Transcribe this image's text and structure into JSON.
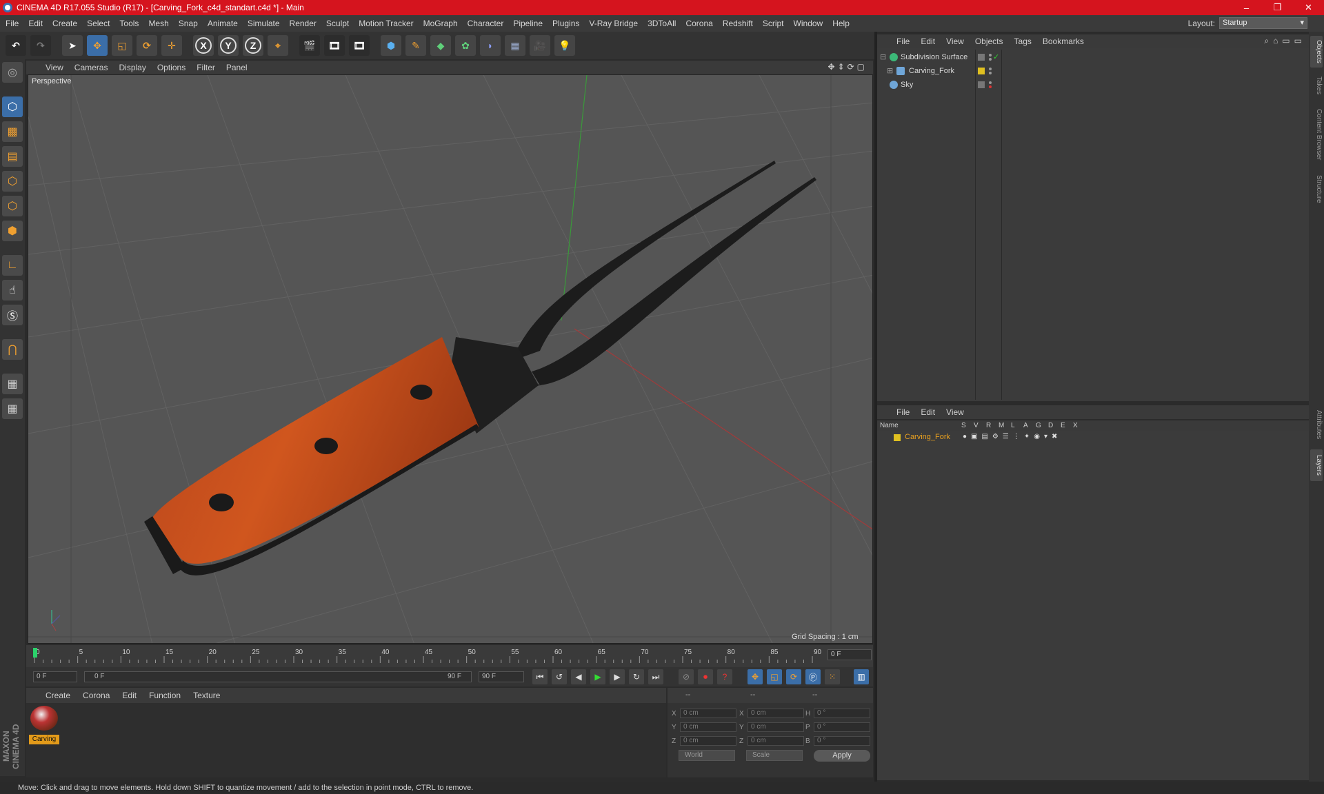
{
  "window": {
    "title": "CINEMA 4D R17.055 Studio (R17) - [Carving_Fork_c4d_standart.c4d *] - Main",
    "controls": [
      "–",
      "❐",
      "✕"
    ]
  },
  "menu": [
    "File",
    "Edit",
    "Create",
    "Select",
    "Tools",
    "Mesh",
    "Snap",
    "Animate",
    "Simulate",
    "Render",
    "Sculpt",
    "Motion Tracker",
    "MoGraph",
    "Character",
    "Pipeline",
    "Plugins",
    "V-Ray Bridge",
    "3DToAll",
    "Corona",
    "Redshift",
    "Script",
    "Window",
    "Help"
  ],
  "layout": {
    "label": "Layout:",
    "value": "Startup"
  },
  "toolbar": {
    "x": "X",
    "y": "Y",
    "z": "Z"
  },
  "viewport": {
    "menu": [
      "View",
      "Cameras",
      "Display",
      "Options",
      "Filter",
      "Panel"
    ],
    "camera": "Perspective",
    "grid_spacing": "Grid Spacing : 1 cm"
  },
  "timeline": {
    "ticks": [
      "0",
      "5",
      "10",
      "15",
      "20",
      "25",
      "30",
      "35",
      "40",
      "45",
      "50",
      "55",
      "60",
      "65",
      "70",
      "75",
      "80",
      "85",
      "90"
    ],
    "current_frame": "0 F"
  },
  "transport": {
    "start": "0 F",
    "range_start": "0 F",
    "range_end": "90 F",
    "end": "90 F"
  },
  "material_manager": {
    "menu": [
      "Create",
      "Corona",
      "Edit",
      "Function",
      "Texture"
    ],
    "material_name": "Carving"
  },
  "coordinates": {
    "headers": [
      "--",
      "--",
      "--"
    ],
    "rows": [
      {
        "a": "X",
        "av": "0 cm",
        "b": "X",
        "bv": "0 cm",
        "c": "H",
        "cv": "0 °"
      },
      {
        "a": "Y",
        "av": "0 cm",
        "b": "Y",
        "bv": "0 cm",
        "c": "P",
        "cv": "0 °"
      },
      {
        "a": "Z",
        "av": "0 cm",
        "b": "Z",
        "bv": "0 cm",
        "c": "B",
        "cv": "0 °"
      }
    ],
    "mode": "World",
    "scale": "Scale",
    "apply": "Apply"
  },
  "object_manager": {
    "menu": [
      "File",
      "Edit",
      "View",
      "Objects",
      "Tags",
      "Bookmarks"
    ],
    "objects": [
      {
        "name": "Subdivision Surface",
        "icon_color": "#3cb878"
      },
      {
        "name": "Carving_Fork",
        "icon_color": "#6fa6d8"
      },
      {
        "name": "Sky",
        "icon_color": "#6fa6d8"
      }
    ]
  },
  "layer_manager": {
    "menu": [
      "File",
      "Edit",
      "View"
    ],
    "columns": [
      "Name",
      "S",
      "V",
      "R",
      "M",
      "L",
      "A",
      "G",
      "D",
      "E",
      "X"
    ],
    "layer": "Carving_Fork",
    "layer_color": "#e0c020"
  },
  "right_tabs": [
    "Objects",
    "Takes",
    "Content Browser",
    "Structure",
    "Attributes",
    "Layers"
  ],
  "status": "Move: Click and drag to move elements. Hold down SHIFT to quantize movement / add to the selection in point mode, CTRL to remove.",
  "brand": "MAXON CINEMA 4D"
}
